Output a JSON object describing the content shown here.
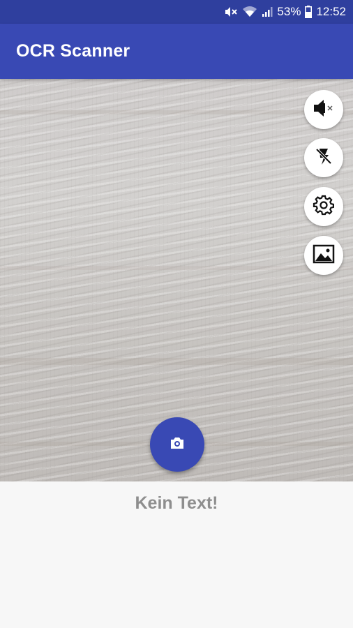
{
  "status_bar": {
    "mute_icon": "volume-muted-icon",
    "wifi_icon": "wifi-icon",
    "signal_icon": "signal-icon",
    "battery_percent": "53%",
    "battery_icon": "battery-icon",
    "time": "12:52"
  },
  "app_bar": {
    "title": "OCR Scanner"
  },
  "camera_controls": [
    {
      "icon": "sound-off-icon"
    },
    {
      "icon": "flash-off-icon"
    },
    {
      "icon": "settings-icon"
    },
    {
      "icon": "gallery-icon"
    }
  ],
  "capture_button": {
    "icon": "camera-icon"
  },
  "result": {
    "text": "Kein Text!"
  },
  "colors": {
    "primary": "#3949b4",
    "status_bar": "#2f3f9e",
    "result_text": "#8e8e8e"
  }
}
